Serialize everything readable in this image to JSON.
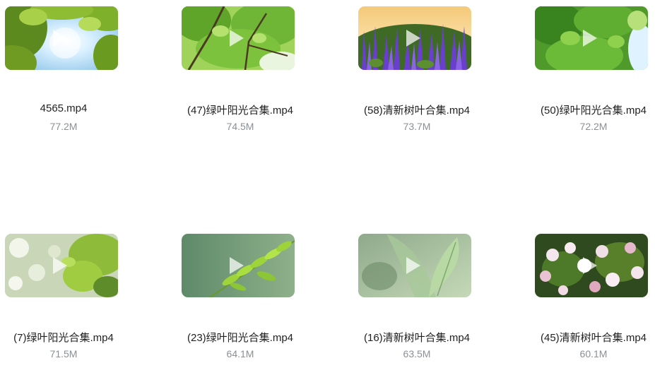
{
  "files": [
    {
      "name": "4565.mp4",
      "size": "77.2M",
      "thumb": "sunlit-canopy"
    },
    {
      "name": "(47)绿叶阳光合集.mp4",
      "size": "74.5M",
      "thumb": "green-tree-branches"
    },
    {
      "name": "(58)清新树叶合集.mp4",
      "size": "73.7M",
      "thumb": "lavender-field"
    },
    {
      "name": "(50)绿叶阳光合集.mp4",
      "size": "72.2M",
      "thumb": "green-leaves"
    },
    {
      "name": "(7)绿叶阳光合集.mp4",
      "size": "71.5M",
      "thumb": "bokeh-leaves"
    },
    {
      "name": "(23)绿叶阳光合集.mp4",
      "size": "64.1M",
      "thumb": "fern-leaves"
    },
    {
      "name": "(16)清新树叶合集.mp4",
      "size": "63.5M",
      "thumb": "single-leaf"
    },
    {
      "name": "(45)清新树叶合集.mp4",
      "size": "60.1M",
      "thumb": "apple-blossoms"
    }
  ],
  "play_icon": "play-icon"
}
